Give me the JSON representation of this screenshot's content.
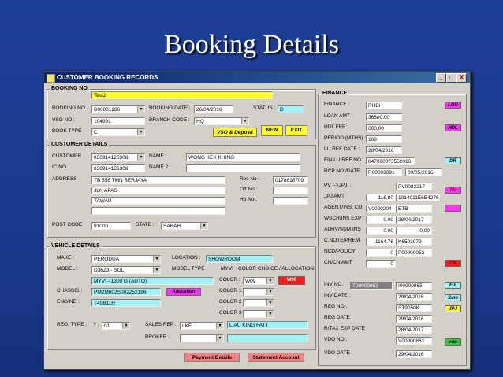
{
  "slide": {
    "title": "Booking Details"
  },
  "window": {
    "title": "CUSTOMER BOOKING RECORDS",
    "min": "_",
    "max": "□",
    "close": "X"
  },
  "booking": {
    "section": "BOOKING NO",
    "booking_no_top": "Test2",
    "booking_no_label": "BOOKING NO",
    "booking_no": "B00001286",
    "booking_date_label": "BOOKING DATE :",
    "booking_date": "26/04/2016",
    "status_label": "STATUS :",
    "status": "D",
    "vso_label": "VSO NO :",
    "vso": "104991",
    "branch_label": "BRANCH CODE :",
    "branch": "HQ",
    "book_type_label": "BOOK TYPE",
    "book_type": "C",
    "vsi_btn": "VSO & Deposit",
    "new_btn": "NEW",
    "exit_btn": "EXIT"
  },
  "customer": {
    "section": "CUSTOMER DETAILS",
    "customer_label": "CUSTOMER",
    "customer": "830914126308",
    "ic_label": "IC NO",
    "ic": "830914126308",
    "name_label": "NAME :",
    "name": "WONG KEK KHING",
    "name2_label": "NAME 2 :",
    "address_label": "ADDRESS",
    "addr1": "TB 558 TMN BERJAYA",
    "addr2": "JLN APAS",
    "addr3": "TAWAU",
    "res_label": "Res No :",
    "res": "0178618709",
    "off_label": "Off No :",
    "hp_label": "Hp No :",
    "postcode_label": "POST CODE",
    "postcode": "91000",
    "state_label": "STATE :",
    "state": "SABAH"
  },
  "vehicle": {
    "section": "VEHICLE DETAILS",
    "make_label": "MAKE :",
    "make": "PERODUA",
    "location_label": "LOCATION :",
    "location": "SHOWROOM",
    "model_label": "MODEL :",
    "model": "D36Z3 - SOL",
    "model_type_label": "MODEL TYPE :",
    "model_type": "MYVI",
    "color_choice_label": "COLOR CHOICE / ALLOCATION",
    "model_desc": "MYVI - 1300 G (AUTO)",
    "color_label": "COLOR :",
    "color": "W09",
    "color_tag": "W09",
    "chassis_label": "CHASSIS :",
    "chassis": "PM2M602S002252196",
    "allocation_btn": "Allocation",
    "color1_label": "COLOR 1 :",
    "engine_label": "ENGINE :",
    "engine": "T49B11H",
    "color2_label": "COLOR 2 :",
    "color3_label": "COLOR 3 :",
    "reg_type_label": "REG. TYPE :",
    "reg_type_y": "Y :",
    "reg_type": "01",
    "sales_rep_label": "SALES REP :",
    "sales_rep": "LKF",
    "sales_rep_name": "LIAU KING FATT",
    "broker_label": "BROKER :"
  },
  "finance": {
    "section": "FINANCE",
    "finance_label": "FINANCE :",
    "finance": "RHBI",
    "loan_label": "LOAN AMT :",
    "loan": "36800.00",
    "hdl_label": "HDL FEE:",
    "hdl": "600.00",
    "period_label": "PERIOD (MTHS) :",
    "period": "108",
    "lu_date_label": "LU REF DATE :",
    "lu_date": "28/04/2016",
    "fin_lu_label": "FIN LU REF NO :",
    "fin_lu": "047000073552016",
    "rcp_label": "RCP NO /DATE:",
    "rcp_no": "R00003091",
    "rcp_date": "09/05/2016",
    "lou_tag": "LOU",
    "hdl_tag": "HDL",
    "dr_tag": "DR",
    "pv_label": "PV -->JPJ. :",
    "pv": "PV0082217",
    "jpj_label": "JPJ AMT",
    "jpj_amt": "116.80",
    "jpj_ref": "1014011E6B4276",
    "agent_label": "AGENT/INS. CO",
    "agent_code": "V0020204",
    "agent": "ETB",
    "wscr_label": "WSCR/INS EXP :",
    "wscr_amt": "0.00",
    "wscr_date": "28/04/2017",
    "adrv_label": "ADRV/SUM INS",
    "adrv1": "0.00",
    "adrv2": "0.00",
    "cnote_label": "C.NOTE/PREM.",
    "cnote_amt": "1164.76",
    "cnote": "K6503079",
    "ncd_label": "NCD/POLICY",
    "ncd": "0",
    "policy": "P00000053",
    "cn_label": "CN/CN AMT",
    "cn": "0",
    "pv_tag": "PV",
    "cn_tag": "CN",
    "inv_label": "INV NO.",
    "inv_prefix": "T00000862",
    "inv": "I00000865",
    "inv_date_label": "INV DATE :",
    "inv_date": "29/04/2016",
    "reg_no_label": "REG NO :",
    "reg_no": "ST9050K",
    "reg_date_label": "REG DATE :",
    "reg_date": "29/04/2016",
    "rtax_label": "R/TAX EXP DATE",
    "rtax": "28/04/2017",
    "vdo_label": "VDO NO :",
    "vdo": "V00000862",
    "vdo_date_label": "VDO DATE :",
    "vdo_date": "29/04/2016",
    "fin_tag": "Fin",
    "sum_tag": "Sum",
    "jpj_tag": "JPJ",
    "vdo_tag": "vdo"
  },
  "footer": {
    "payment_btn": "Payment Details",
    "statement_btn": "Statement Account"
  },
  "colors": {
    "cyan": "#9ff2f7",
    "yellow": "#ffff24",
    "magenta": "#ff33ff",
    "red": "#ff1a1a",
    "pink": "#ff8080"
  }
}
